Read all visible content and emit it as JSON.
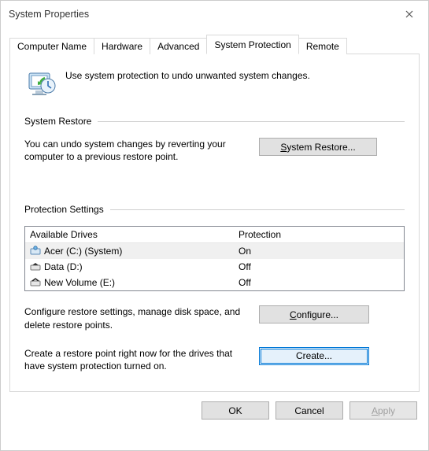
{
  "window": {
    "title": "System Properties"
  },
  "tabs": {
    "computer_name": "Computer Name",
    "hardware": "Hardware",
    "advanced": "Advanced",
    "system_protection": "System Protection",
    "remote": "Remote"
  },
  "intro": "Use system protection to undo unwanted system changes.",
  "system_restore": {
    "heading": "System Restore",
    "text": "You can undo system changes by reverting your computer to a previous restore point.",
    "button_prefix": "S",
    "button_rest": "ystem Restore..."
  },
  "protection_settings": {
    "heading": "Protection Settings",
    "col_drives": "Available Drives",
    "col_protection": "Protection",
    "rows": [
      {
        "name": "Acer (C:) (System)",
        "protection": "On"
      },
      {
        "name": "Data (D:)",
        "protection": "Off"
      },
      {
        "name": "New Volume (E:)",
        "protection": "Off"
      }
    ],
    "configure_text": "Configure restore settings, manage disk space, and delete restore points.",
    "configure_prefix": "C",
    "configure_rest": "onfigure...",
    "create_text": "Create a restore point right now for the drives that have system protection turned on.",
    "create_prefix": "C",
    "create_rest": "reate..."
  },
  "footer": {
    "ok": "OK",
    "cancel": "Cancel",
    "apply_prefix": "A",
    "apply_rest": "pply"
  }
}
